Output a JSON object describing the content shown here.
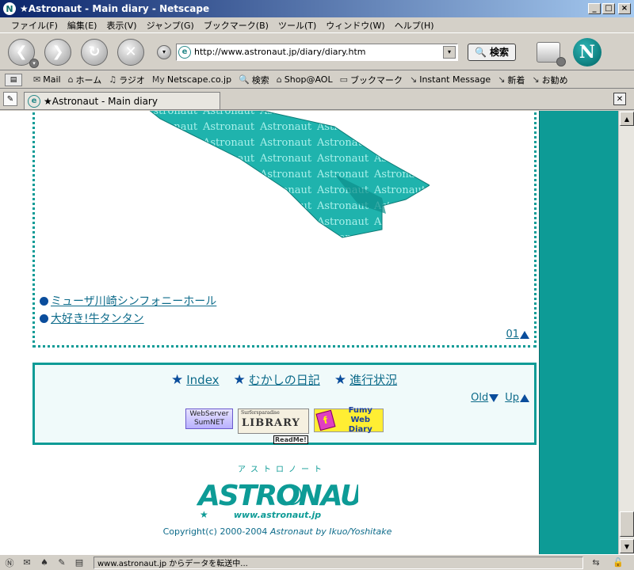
{
  "window": {
    "title": "★Astronaut - Main diary - Netscape",
    "buttons": {
      "minimize": "_",
      "maximize": "□",
      "close": "×"
    }
  },
  "menu": [
    "ファイル(F)",
    "編集(E)",
    "表示(V)",
    "ジャンプ(G)",
    "ブックマーク(B)",
    "ツール(T)",
    "ウィンドウ(W)",
    "ヘルプ(H)"
  ],
  "toolbar": {
    "url": "http://www.astronaut.jp/diary/diary.htm",
    "search_label": "検索"
  },
  "bookmarks": [
    {
      "icon": "mail-icon",
      "glyph": "✉",
      "label": "Mail"
    },
    {
      "icon": "home-icon",
      "glyph": "⌂",
      "label": "ホーム"
    },
    {
      "icon": "radio-icon",
      "glyph": "♫",
      "label": "ラジオ"
    },
    {
      "icon": "my-netscape-icon",
      "glyph": "My",
      "label": "Netscape.co.jp"
    },
    {
      "icon": "search-icon",
      "glyph": "🔍",
      "label": "検索"
    },
    {
      "icon": "shop-icon",
      "glyph": "⌂",
      "label": "Shop@AOL"
    },
    {
      "icon": "folder-icon",
      "glyph": "▭",
      "label": "ブックマーク"
    },
    {
      "icon": "link-icon",
      "glyph": "↘",
      "label": "Instant Message"
    },
    {
      "icon": "link-icon",
      "glyph": "↘",
      "label": "新着"
    },
    {
      "icon": "link-icon",
      "glyph": "↘",
      "label": "お勧め"
    }
  ],
  "tab": {
    "label": "★Astronaut - Main diary"
  },
  "page": {
    "links": [
      "ミューザ川崎シンフォニーホール",
      "大好き!牛タンタン"
    ],
    "page_number": "01",
    "nav": {
      "items": [
        {
          "label": "Index"
        },
        {
          "label": "むかしの日記"
        },
        {
          "label": "進行状況"
        }
      ],
      "old_label": "Old",
      "up_label": "Up"
    },
    "badges": {
      "webserver": [
        "WebServer",
        "SumNET"
      ],
      "library_top": "Surfersparadise",
      "library_main": "LIBRARY",
      "library_readme": "ReadMe!",
      "fumy": [
        "Fumy",
        "Web Diary"
      ]
    },
    "footer": {
      "logo_text": "ASTRONAUT",
      "logo_kana": "アストロノート",
      "url": "www.astronaut.jp",
      "copyright_prefix": "Copyright(c) 2000-2004 ",
      "copyright_author": "Astronaut by Ikuo/Yoshitake"
    }
  },
  "status": {
    "text": "www.astronaut.jp からデータを転送中..."
  },
  "colors": {
    "accent_teal": "#0d9b96",
    "link_blue": "#0d6b8a",
    "bullet_navy": "#0a4d9c"
  }
}
